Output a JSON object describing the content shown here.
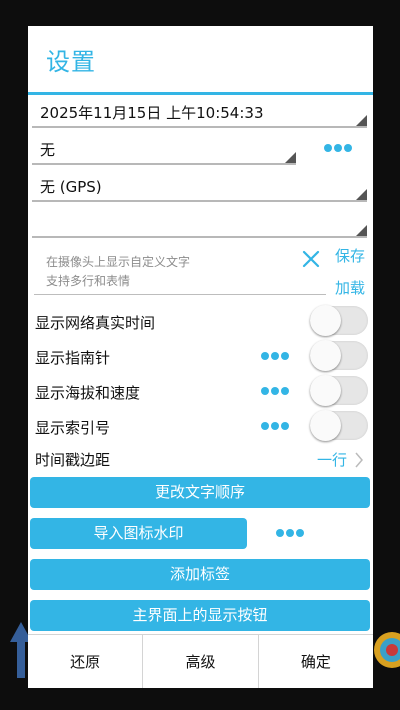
{
  "dialog": {
    "title": "设置",
    "datetime_value": "2025年11月15日 上午10:54:33",
    "location_value": "无",
    "gps_value": "无 (GPS)",
    "blank_spinner_value": "",
    "custom_text_placeholder": "在摄像头上显示自定义文字\n支持多行和表情",
    "save_label": "保存",
    "load_label": "加载",
    "toggles": [
      {
        "label": "显示网络真实时间",
        "on": false
      },
      {
        "label": "显示指南针",
        "on": false
      },
      {
        "label": "显示海拔和速度",
        "on": false
      },
      {
        "label": "显示索引号",
        "on": false
      }
    ],
    "time_margin_label": "时间戳边距",
    "time_margin_value": "一行",
    "buttons": {
      "change_order": "更改文字顺序",
      "import_watermark": "导入图标水印",
      "add_tag": "添加标签",
      "main_buttons": "主界面上的显示按钮"
    },
    "footer": {
      "restore": "还原",
      "advanced": "高级",
      "confirm": "确定"
    }
  },
  "colors": {
    "accent": "#33b5e5",
    "toggle_off": "#e6e6e6"
  }
}
